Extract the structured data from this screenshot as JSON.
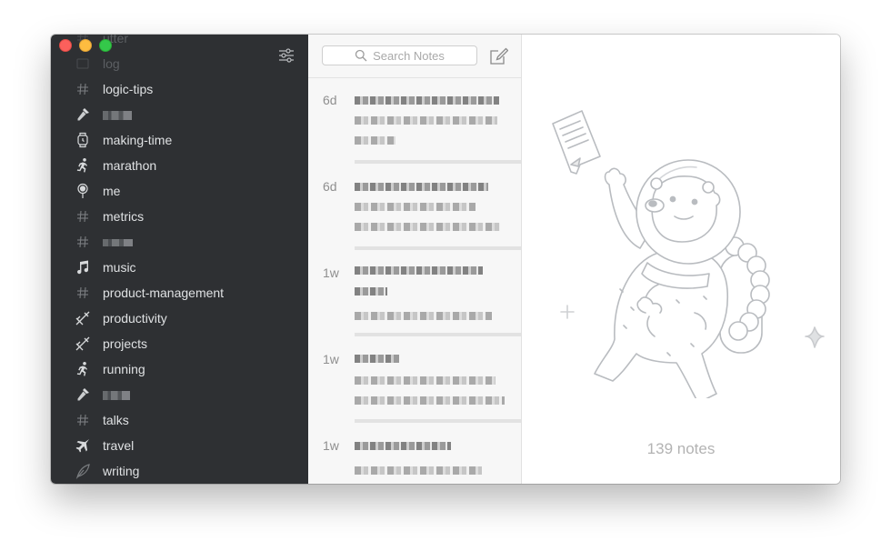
{
  "window": {
    "controls": [
      "close",
      "minimize",
      "zoom"
    ]
  },
  "sidebar": {
    "filter_icon": "sliders-icon",
    "tags": [
      {
        "label": "utter",
        "icon": "hash-icon",
        "faded": true
      },
      {
        "label": "log",
        "icon": "hash-icon",
        "faded": true
      },
      {
        "label": "logic-tips",
        "icon": "hash-icon"
      },
      {
        "label": "",
        "icon": "microphone-icon",
        "redacted": true
      },
      {
        "label": "making-time",
        "icon": "watch-icon"
      },
      {
        "label": "marathon",
        "icon": "runner-icon"
      },
      {
        "label": "me",
        "icon": "pushpin-icon"
      },
      {
        "label": "metrics",
        "icon": "hash-icon"
      },
      {
        "label": "",
        "icon": "hash-icon",
        "redacted": true
      },
      {
        "label": "music",
        "icon": "music-note-icon"
      },
      {
        "label": "product-management",
        "icon": "hash-icon"
      },
      {
        "label": "productivity",
        "icon": "tools-icon"
      },
      {
        "label": "projects",
        "icon": "tools-icon"
      },
      {
        "label": "running",
        "icon": "runner-icon"
      },
      {
        "label": "",
        "icon": "microphone-icon",
        "redacted": true
      },
      {
        "label": "talks",
        "icon": "hash-icon"
      },
      {
        "label": "travel",
        "icon": "airplane-icon"
      },
      {
        "label": "writing",
        "icon": "quill-icon"
      }
    ]
  },
  "notes_list": {
    "search_placeholder": "Search Notes",
    "compose_icon": "compose-icon",
    "notes": [
      {
        "date": "6d"
      },
      {
        "date": "6d"
      },
      {
        "date": "1w"
      },
      {
        "date": "1w"
      },
      {
        "date": "1w"
      }
    ]
  },
  "main": {
    "note_count": "139 notes",
    "illustration": "astronaut-bear-illustration"
  }
}
